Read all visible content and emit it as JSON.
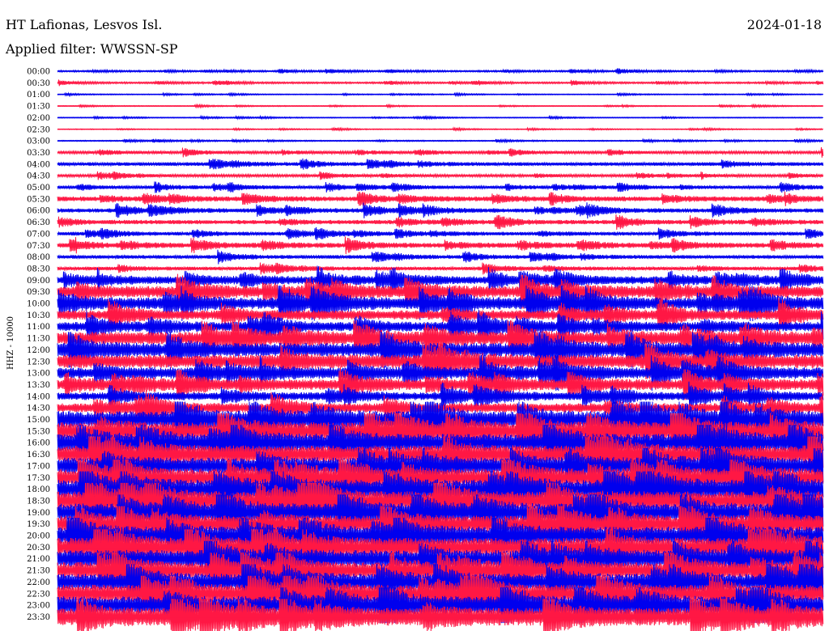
{
  "header": {
    "station": "HT Lafionas, Lesvos Isl.",
    "date": "2024-01-18",
    "filter": "Applied filter: WWSSN-SP"
  },
  "scale_label": "HHZ - 10000",
  "colors": {
    "even_trace": "#0000ee",
    "odd_trace": "#ff1744",
    "background": "#ffffff",
    "text": "#000000"
  },
  "chart_data": {
    "type": "helicorder",
    "row_labels": [
      "00:00",
      "00:30",
      "01:00",
      "01:30",
      "02:00",
      "02:30",
      "03:00",
      "03:30",
      "04:00",
      "04:30",
      "05:00",
      "05:30",
      "06:00",
      "06:30",
      "07:00",
      "07:30",
      "08:00",
      "08:30",
      "09:00",
      "09:30",
      "10:00",
      "10:30",
      "11:00",
      "11:30",
      "12:00",
      "12:30",
      "13:00",
      "13:30",
      "14:00",
      "14:30",
      "15:00",
      "15:30",
      "16:00",
      "16:30",
      "17:00",
      "17:30",
      "18:00",
      "18:30",
      "19:00",
      "19:30",
      "20:00",
      "20:30",
      "21:00",
      "21:30",
      "22:00",
      "22:30",
      "23:00",
      "23:30"
    ],
    "relative_amplitude": [
      0.3,
      0.3,
      0.15,
      0.15,
      0.15,
      0.15,
      0.2,
      0.5,
      0.7,
      0.5,
      0.6,
      0.9,
      0.8,
      0.8,
      0.7,
      0.9,
      0.7,
      0.7,
      1.5,
      2.2,
      2.2,
      1.8,
      1.8,
      2.4,
      2.6,
      2.6,
      2.2,
      2.0,
      1.5,
      1.8,
      3.2,
      3.4,
      3.4,
      3.4,
      3.2,
      3.4,
      3.6,
      3.6,
      3.4,
      3.2,
      3.4,
      3.6,
      3.4,
      3.2,
      3.2,
      3.4,
      3.4,
      3.4
    ]
  }
}
